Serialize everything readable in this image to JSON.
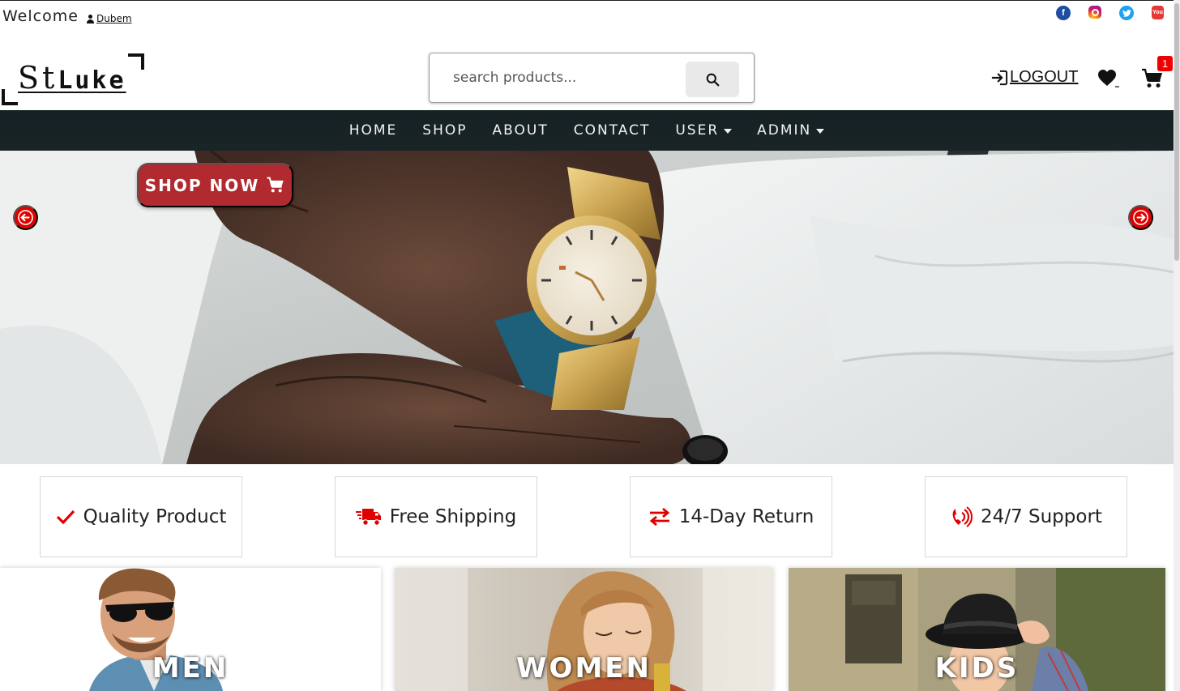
{
  "topbar": {
    "welcome_text": "Welcome",
    "username": "Dubem",
    "socials": [
      "facebook-icon",
      "instagram-icon",
      "twitter-icon",
      "youtube-icon"
    ],
    "youtube_text": "You"
  },
  "header": {
    "logo_main": "St",
    "logo_sub": "Luke",
    "search_placeholder": "search products...",
    "logout_label": "LOGOUT",
    "cart_count": "1"
  },
  "nav": {
    "items": [
      "HOME",
      "SHOP",
      "ABOUT",
      "CONTACT",
      "USER",
      "ADMIN"
    ]
  },
  "hero": {
    "cta_label": "SHOP NOW"
  },
  "features": [
    {
      "label": "Quality Product",
      "icon": "check-icon"
    },
    {
      "label": "Free Shipping",
      "icon": "truck-icon"
    },
    {
      "label": "14-Day Return",
      "icon": "exchange-arrows-icon"
    },
    {
      "label": "24/7 Support",
      "icon": "phone-volume-icon"
    }
  ],
  "categories": [
    {
      "label": "MEN"
    },
    {
      "label": "WOMEN"
    },
    {
      "label": "KIDS"
    }
  ],
  "colors": {
    "accent_red": "#e00000",
    "cta_red": "#b02a2f",
    "nav_bg": "#1a2426"
  }
}
